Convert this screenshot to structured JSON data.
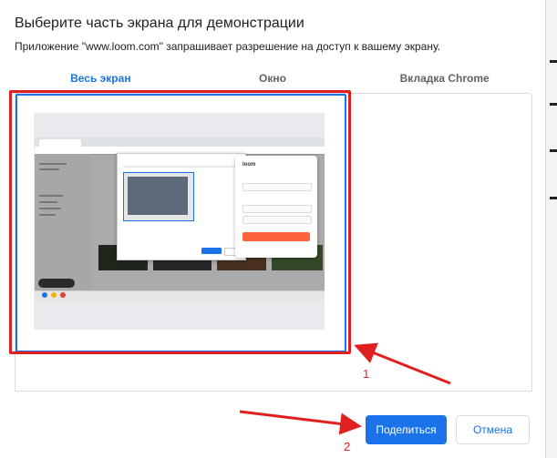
{
  "dialog": {
    "title": "Выберите часть экрана для демонстрации",
    "subtitle": "Приложение \"www.loom.com\" запрашивает разрешение на доступ к вашему экрану."
  },
  "tabs": [
    {
      "label": "Весь экран",
      "active": true
    },
    {
      "label": "Окно",
      "active": false
    },
    {
      "label": "Вкладка Chrome",
      "active": false
    }
  ],
  "preview": {
    "loom_logo": "loom"
  },
  "buttons": {
    "share": "Поделиться",
    "cancel": "Отмена"
  },
  "annotations": {
    "marker_1": "1",
    "marker_2": "2",
    "color": "#e02020"
  },
  "colors": {
    "accent": "#1a73e8",
    "annotation": "#e02020",
    "loom_start": "#ff623e"
  }
}
